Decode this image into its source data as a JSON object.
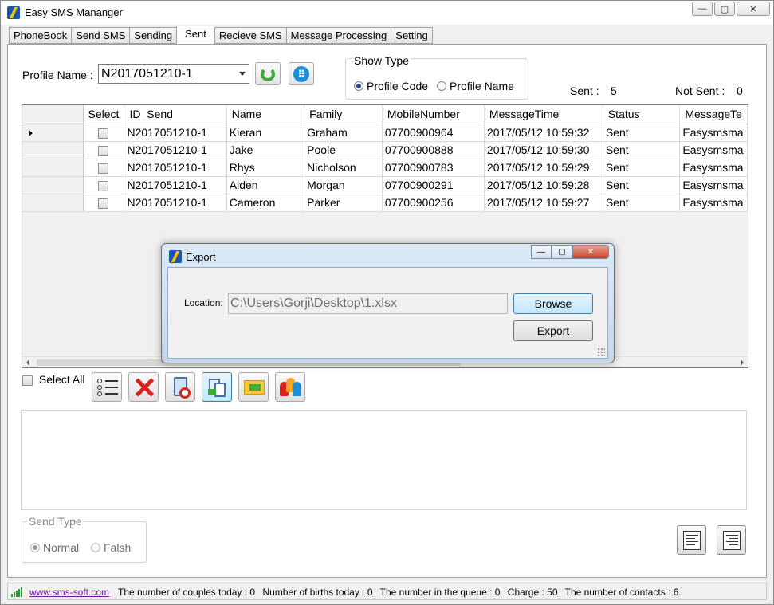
{
  "window": {
    "title": "Easy SMS Mananger",
    "controls": {
      "minimize": "—",
      "maximize": "▢",
      "close": "✕"
    }
  },
  "tabs": [
    {
      "label": "PhoneBook",
      "active": false
    },
    {
      "label": "Send SMS",
      "active": false
    },
    {
      "label": "Sending",
      "active": false
    },
    {
      "label": "Sent",
      "active": true
    },
    {
      "label": "Recieve SMS",
      "active": false
    },
    {
      "label": "Message Processing",
      "active": false
    },
    {
      "label": "Setting",
      "active": false
    }
  ],
  "profile": {
    "label": "Profile Name :",
    "selected": "N2017051210-1"
  },
  "show_type": {
    "legend": "Show Type",
    "options": [
      {
        "label": "Profile Code",
        "checked": true
      },
      {
        "label": "Profile Name",
        "checked": false
      }
    ]
  },
  "counts": {
    "sent_label": "Sent :",
    "sent_value": "5",
    "not_sent_label": "Not Sent :",
    "not_sent_value": "0"
  },
  "grid": {
    "columns": [
      "Select",
      "ID_Send",
      "Name",
      "Family",
      "MobileNumber",
      "MessageTime",
      "Status",
      "MessageTe"
    ],
    "rows": [
      {
        "id_send": "N2017051210-1",
        "name": "Kieran",
        "family": "Graham",
        "mobile": "07700900964",
        "time": "2017/05/12 10:59:32",
        "status": "Sent",
        "message": "Easysmsma"
      },
      {
        "id_send": "N2017051210-1",
        "name": "Jake",
        "family": "Poole",
        "mobile": "07700900888",
        "time": "2017/05/12 10:59:30",
        "status": "Sent",
        "message": "Easysmsma"
      },
      {
        "id_send": "N2017051210-1",
        "name": "Rhys",
        "family": "Nicholson",
        "mobile": "07700900783",
        "time": "2017/05/12 10:59:29",
        "status": "Sent",
        "message": "Easysmsma"
      },
      {
        "id_send": "N2017051210-1",
        "name": "Aiden",
        "family": "Morgan",
        "mobile": "07700900291",
        "time": "2017/05/12 10:59:28",
        "status": "Sent",
        "message": "Easysmsma"
      },
      {
        "id_send": "N2017051210-1",
        "name": "Cameron",
        "family": "Parker",
        "mobile": "07700900256",
        "time": "2017/05/12 10:59:27",
        "status": "Sent",
        "message": "Easysmsma"
      }
    ]
  },
  "select_all": {
    "label": "Select All"
  },
  "send_type": {
    "legend": "Send Type",
    "options": [
      {
        "label": "Normal",
        "checked": true
      },
      {
        "label": "Falsh",
        "checked": false
      }
    ]
  },
  "status_bar": {
    "link": "www.sms-soft.com",
    "items": [
      "The number of couples today : 0",
      "Number of births today : 0",
      "The number in the queue : 0",
      "Charge : 50",
      "The number of contacts : 6"
    ]
  },
  "export_dialog": {
    "title": "Export",
    "location_label": "Location:",
    "location_value": "C:\\Users\\Gorji\\Desktop\\1.xlsx",
    "browse_label": "Browse",
    "export_label": "Export"
  },
  "colors": {
    "accent_green": "#3eaa3a",
    "accent_blue": "#1d8fd9",
    "delete_red": "#d8231c",
    "link_purple": "#6a1b9a"
  },
  "icons": {
    "refresh": "refresh-icon",
    "keypad": "keypad-icon",
    "list": "list-icon",
    "delete": "delete-icon",
    "trash": "trash-icon",
    "export": "export-icon",
    "mail": "mail-icon",
    "group": "group-icon",
    "align_left": "align-left-icon",
    "align_right": "align-right-icon"
  }
}
